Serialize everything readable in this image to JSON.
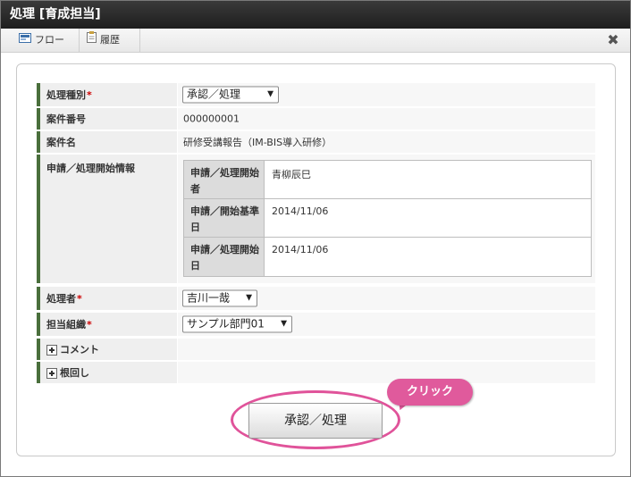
{
  "window": {
    "title": "処理 [育成担当]"
  },
  "toolbar": {
    "flow_label": "フロー",
    "history_label": "履歴",
    "close_icon": "close-icon"
  },
  "form": {
    "process_type": {
      "label": "処理種別",
      "required_mark": "*",
      "value": "承認／処理"
    },
    "case_number": {
      "label": "案件番号",
      "value": "000000001"
    },
    "case_name": {
      "label": "案件名",
      "value": "研修受講報告（IM-BIS導入研修）"
    },
    "start_info": {
      "label": "申請／処理開始情報",
      "rows": [
        {
          "label": "申請／処理開始者",
          "value": "青柳辰巳"
        },
        {
          "label": "申請／開始基準日",
          "value": "2014/11/06"
        },
        {
          "label": "申請／処理開始日",
          "value": "2014/11/06"
        }
      ]
    },
    "processor": {
      "label": "処理者",
      "required_mark": "*",
      "value": "吉川一哉"
    },
    "org": {
      "label": "担当組織",
      "required_mark": "*",
      "value": "サンプル部門01"
    },
    "comment": {
      "label": "コメント"
    },
    "nemawashi": {
      "label": "根回し"
    }
  },
  "action": {
    "submit_label": "承認／処理"
  },
  "callout": {
    "text": "クリック",
    "color": "#e05a9c"
  },
  "colors": {
    "accent_bar": "#4a6f3c",
    "required": "#cc0000",
    "highlight": "#e0539a"
  }
}
